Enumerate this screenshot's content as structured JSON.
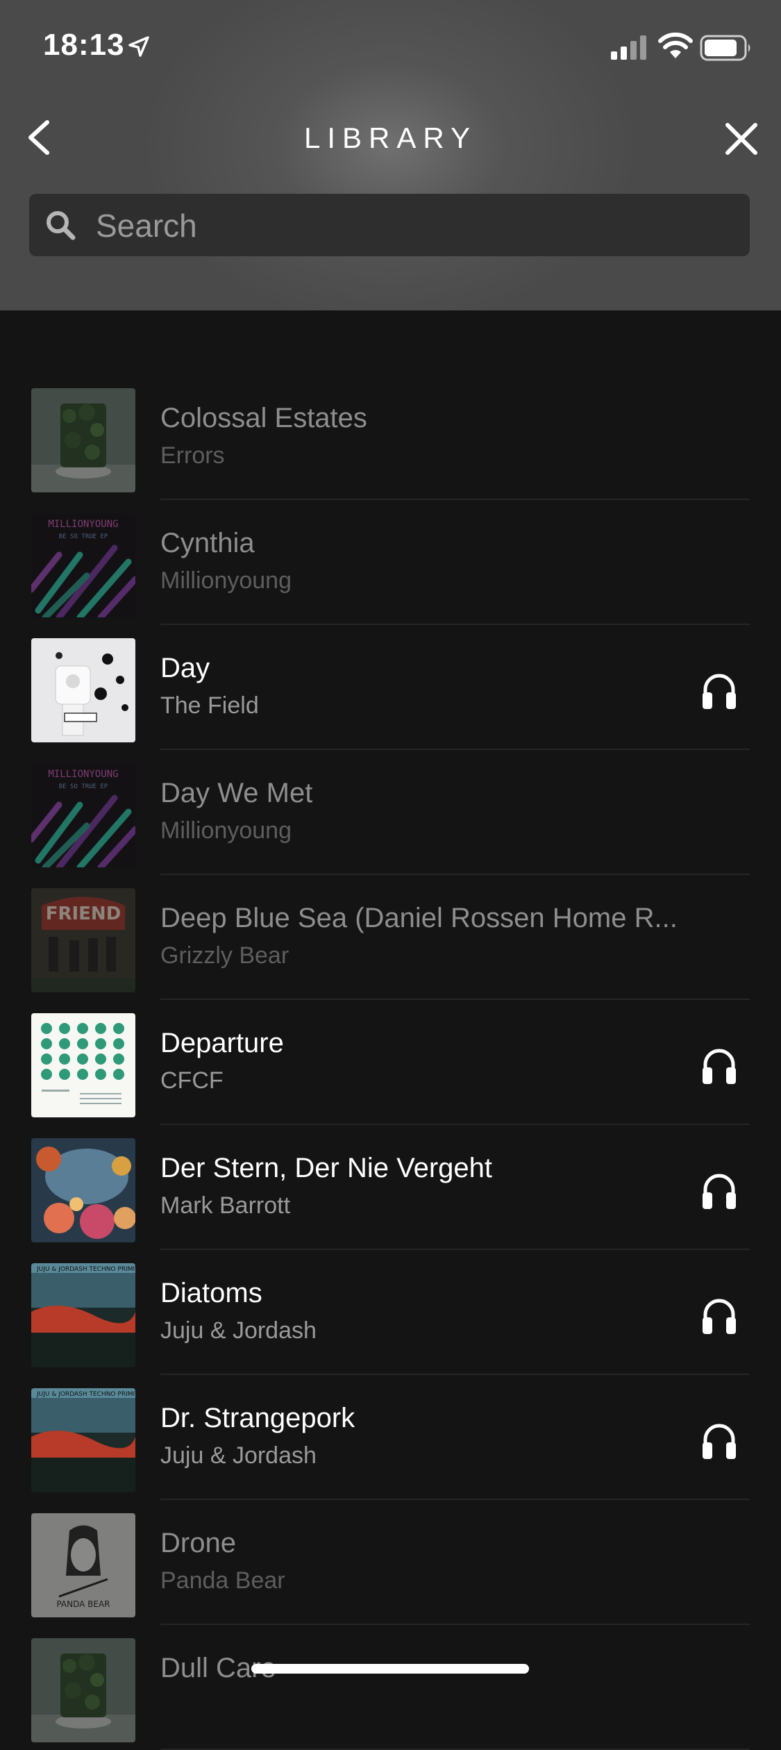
{
  "status_bar": {
    "time": "18:13",
    "icons": [
      "location-arrow-icon",
      "cellular-signal-icon",
      "wifi-icon",
      "battery-icon"
    ]
  },
  "header": {
    "title": "LIBRARY",
    "back_icon": "chevron-left-icon",
    "close_icon": "close-icon"
  },
  "search": {
    "placeholder": "Search",
    "value": "",
    "icon": "search-icon"
  },
  "colors": {
    "background": "#141414",
    "header_gradient": "#707070",
    "search_bg": "#2e2e2e",
    "text_primary": "#ffffff",
    "text_secondary": "#9a9a9a",
    "text_dim": "#8e8e8e"
  },
  "tracks": [
    {
      "title": "Colossal Estates",
      "artist": "Errors",
      "available": false,
      "headphones": false
    },
    {
      "title": "Cynthia",
      "artist": "Millionyoung",
      "available": false,
      "headphones": false
    },
    {
      "title": "Day",
      "artist": "The Field",
      "available": true,
      "headphones": true
    },
    {
      "title": "Day We Met",
      "artist": "Millionyoung",
      "available": false,
      "headphones": false
    },
    {
      "title": "Deep Blue Sea (Daniel Rossen Home R...",
      "artist": "Grizzly Bear",
      "available": false,
      "headphones": false
    },
    {
      "title": "Departure",
      "artist": "CFCF",
      "available": true,
      "headphones": true
    },
    {
      "title": "Der Stern, Der Nie Vergeht",
      "artist": "Mark Barrott",
      "available": true,
      "headphones": true
    },
    {
      "title": "Diatoms",
      "artist": "Juju & Jordash",
      "available": true,
      "headphones": true
    },
    {
      "title": "Dr. Strangepork",
      "artist": "Juju & Jordash",
      "available": true,
      "headphones": true
    },
    {
      "title": "Drone",
      "artist": "Panda Bear",
      "available": false,
      "headphones": false
    },
    {
      "title": "Dull Care",
      "artist": "",
      "available": false,
      "headphones": false
    }
  ]
}
